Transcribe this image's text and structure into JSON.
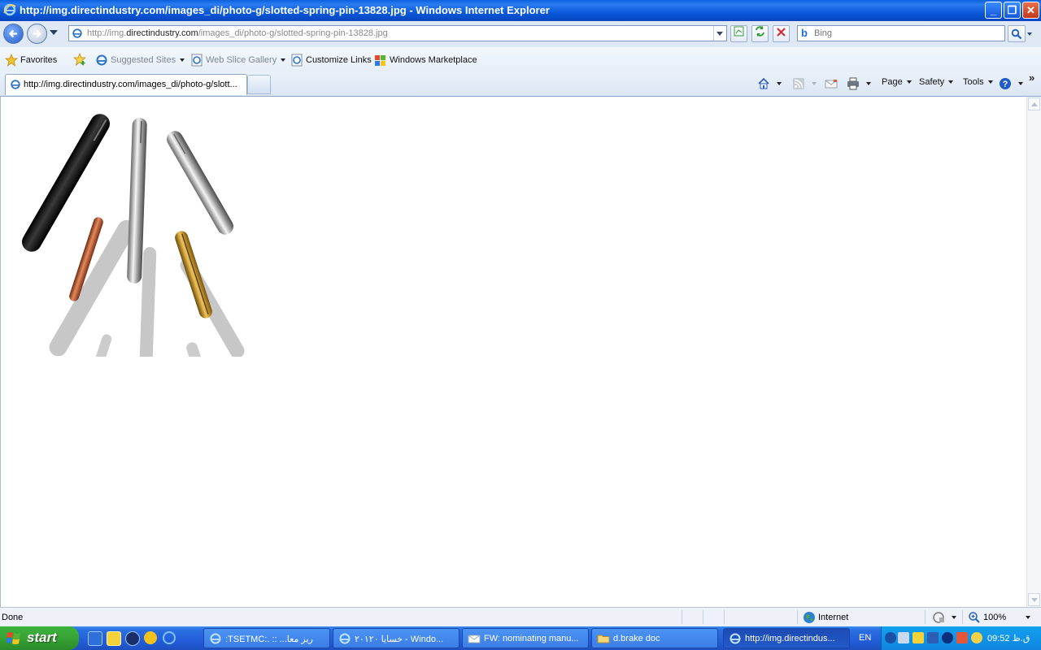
{
  "window": {
    "title": "http://img.directindustry.com/images_di/photo-g/slotted-spring-pin-13828.jpg - Windows Internet Explorer",
    "minimize": "_",
    "restore": "❐",
    "close": "✕"
  },
  "address": {
    "url_prefix": "http://img.",
    "url_host": "directindustry.com",
    "url_path": "/images_di/photo-g/slotted-spring-pin-13828.jpg"
  },
  "search": {
    "placeholder": "Bing"
  },
  "favorites_bar": {
    "favorites": "Favorites",
    "items": [
      {
        "label": "Suggested Sites"
      },
      {
        "label": "Web Slice Gallery"
      },
      {
        "label": "Customize Links"
      },
      {
        "label": "Windows Marketplace"
      }
    ]
  },
  "tab": {
    "title": "http://img.directindustry.com/images_di/photo-g/slott..."
  },
  "command_bar": {
    "page": "Page",
    "safety": "Safety",
    "tools": "Tools"
  },
  "status": {
    "text": "Done",
    "zone": "Internet",
    "zoom": "100%"
  },
  "taskbar": {
    "start": "start",
    "buttons": [
      {
        "label": ":TSETMC:. :: ...ریز معا"
      },
      {
        "label": "خسایا ۲۰۱۲۰ - Windo..."
      },
      {
        "label": "FW: nominating manu..."
      },
      {
        "label": "d.brake doc"
      },
      {
        "label": "http://img.directindus..."
      }
    ],
    "lang": "EN",
    "clock": "09:52 ق.ظ"
  }
}
